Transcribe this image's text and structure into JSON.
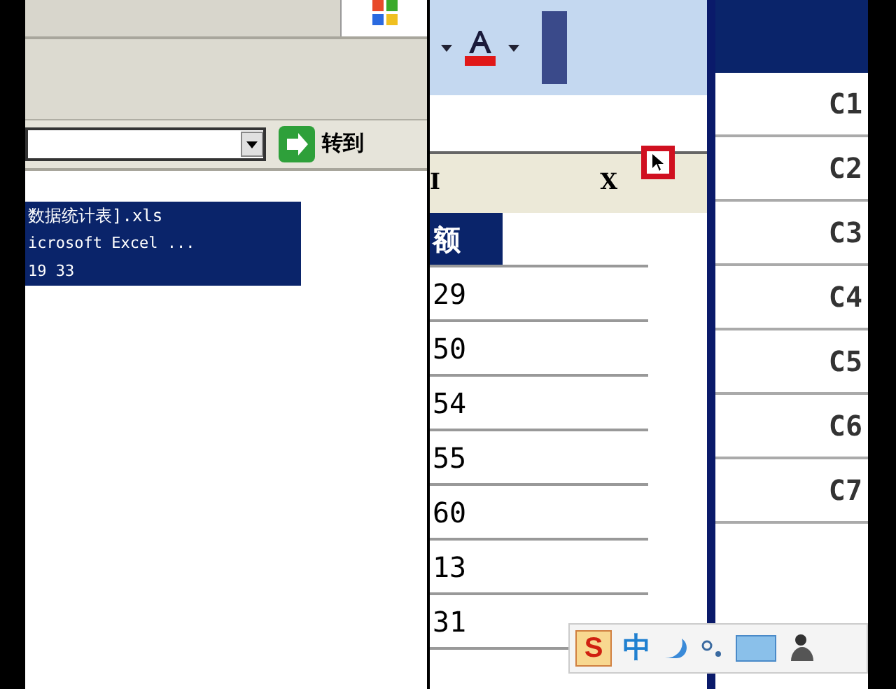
{
  "explorer": {
    "go_button": "转到",
    "files": [
      {
        "name": "数据统计表].xls",
        "type": "icrosoft Excel ...",
        "size": "19 33",
        "selected": true
      }
    ]
  },
  "excel": {
    "header_cells": [
      "I",
      "X"
    ],
    "column_cells": [
      {
        "text": "额",
        "selected": true
      },
      {
        "text": "29",
        "selected": false
      },
      {
        "text": "50",
        "selected": false
      },
      {
        "text": "54",
        "selected": false
      },
      {
        "text": "55",
        "selected": false
      },
      {
        "text": "60",
        "selected": false
      },
      {
        "text": "13",
        "selected": false
      },
      {
        "text": "31",
        "selected": false
      }
    ],
    "right_cells": [
      "C1",
      "C2",
      "C3",
      "C4",
      "C5",
      "C6",
      "C7"
    ]
  },
  "ime_toolbar": {
    "logo": "S",
    "mode": "中"
  }
}
